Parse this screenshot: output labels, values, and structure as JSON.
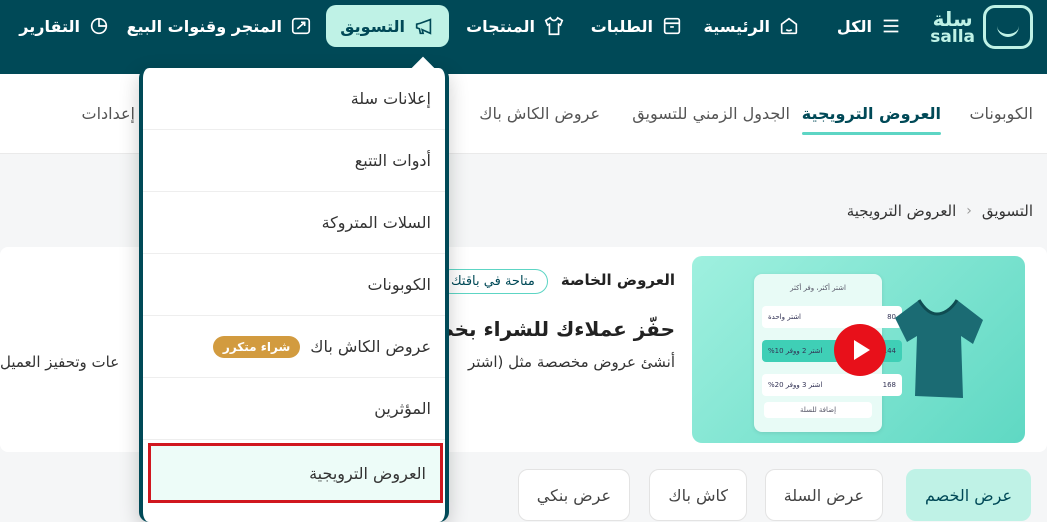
{
  "app": {
    "logo_ar": "سلة",
    "logo_en": "salla"
  },
  "nav": {
    "all": "الكل",
    "home": "الرئيسية",
    "orders": "الطلبات",
    "products": "المنتجات",
    "marketing": "التسويق",
    "store_channels": "المتجر وقنوات البيع",
    "reports": "التقارير"
  },
  "subtabs": {
    "coupons": "الكوبونات",
    "promotions": "العروض الترويجية",
    "schedule": "الجدول الزمني للتسويق",
    "cashback": "عروض الكاش باك",
    "settings": "إعدادات"
  },
  "breadcrumb": {
    "root": "التسويق",
    "current": "العروض الترويجية",
    "separator": "‹"
  },
  "card": {
    "label": "العروض الخاصة",
    "badge": "متاحة في باقتك",
    "title": "حفّز عملاءك للشراء بخصو",
    "desc": "أنشئ عروض مخصصة مثل (اشتر",
    "desc_tail": "عات وتحفيز العميل",
    "mock": {
      "title": "اشتر أكثر، وفر أكثر",
      "rows": [
        {
          "label": "اشتر واحدة",
          "price": "80"
        },
        {
          "label": "اشتر 2 ووفر 10%",
          "price": "144"
        },
        {
          "label": "اشتر 3 ووفر 20%",
          "price": "168"
        }
      ],
      "button": "إضافة للسلة"
    }
  },
  "chips": {
    "discount": "عرض الخصم",
    "cart": "عرض السلة",
    "cashback": "كاش باك",
    "bank": "عرض بنكي"
  },
  "dropdown": {
    "items": [
      {
        "label": "إعلانات سلة"
      },
      {
        "label": "أدوات التتبع"
      },
      {
        "label": "السلات المتروكة"
      },
      {
        "label": "الكوبونات"
      },
      {
        "label": "عروض الكاش باك",
        "tag": "شراء متكرر"
      },
      {
        "label": "المؤثرين"
      },
      {
        "label": "العروض الترويجية"
      }
    ]
  },
  "colors": {
    "primary": "#004957",
    "accent": "#bff2e6",
    "highlight_border": "#d0171f",
    "tag": "#d29b3f"
  }
}
